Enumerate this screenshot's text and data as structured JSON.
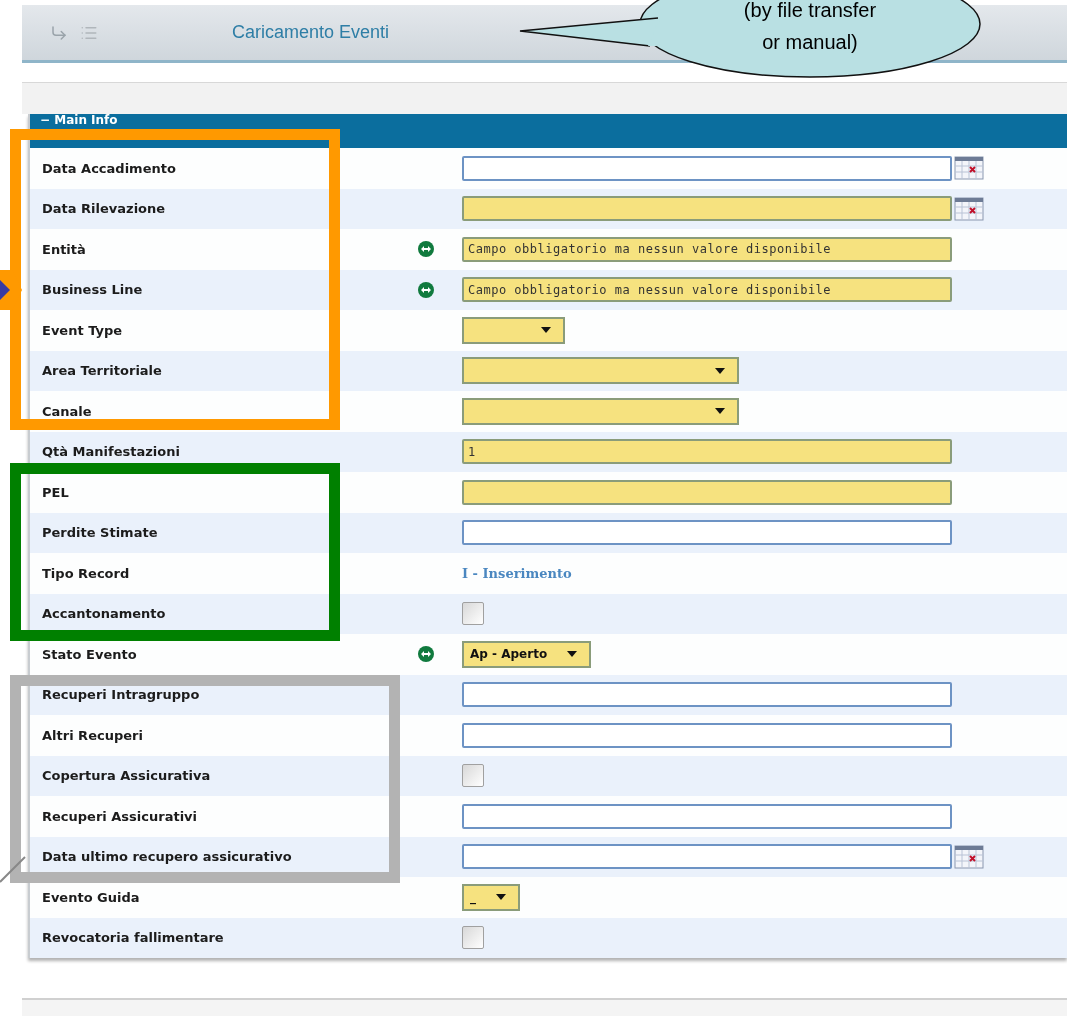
{
  "header": {
    "title": "Caricamento Eventi"
  },
  "callout": {
    "lines": [
      "(by file transfer",
      "or manual)"
    ]
  },
  "section": {
    "title": "− Main Info"
  },
  "rows": [
    {
      "label": "Data Accadimento",
      "kind": "date",
      "required": false,
      "linked": false
    },
    {
      "label": "Data Rilevazione",
      "kind": "date",
      "required": true,
      "linked": false
    },
    {
      "label": "Entità",
      "kind": "text",
      "required": true,
      "linked": true,
      "value": "Campo obbligatorio ma nessun valore disponibile"
    },
    {
      "label": "Business Line",
      "kind": "text",
      "required": true,
      "linked": true,
      "value": "Campo obbligatorio ma nessun valore disponibile"
    },
    {
      "label": "Event Type",
      "kind": "select",
      "required": true,
      "linked": false
    },
    {
      "label": "Area Territoriale",
      "kind": "combo",
      "required": true,
      "linked": false
    },
    {
      "label": "Canale",
      "kind": "combo",
      "required": true,
      "linked": false
    },
    {
      "label": "Qtà Manifestazioni",
      "kind": "text",
      "required": true,
      "linked": false,
      "value": "1"
    },
    {
      "label": "PEL",
      "kind": "text",
      "required": true,
      "linked": false
    },
    {
      "label": "Perdite Stimate",
      "kind": "text",
      "required": false,
      "linked": false
    },
    {
      "label": "Tipo Record",
      "kind": "static",
      "linked": false,
      "value": "I - Inserimento"
    },
    {
      "label": "Accantonamento",
      "kind": "checkbox",
      "checked": false,
      "linked": false
    },
    {
      "label": "Stato Evento",
      "kind": "select",
      "required": true,
      "linked": true,
      "value": "Ap - Aperto"
    },
    {
      "label": "Recuperi Intragruppo",
      "kind": "text",
      "required": false,
      "linked": false
    },
    {
      "label": "Altri Recuperi",
      "kind": "text",
      "required": false,
      "linked": false
    },
    {
      "label": "Copertura Assicurativa",
      "kind": "checkbox",
      "checked": false,
      "linked": false
    },
    {
      "label": "Recuperi Assicurativi",
      "kind": "text",
      "required": false,
      "linked": false
    },
    {
      "label": "Data ultimo recupero assicurativo",
      "kind": "date",
      "required": false,
      "linked": false
    },
    {
      "label": "Evento Guida",
      "kind": "select",
      "required": true,
      "linked": false,
      "value": "_"
    },
    {
      "label": "Revocatoria fallimentare",
      "kind": "checkbox",
      "checked": false,
      "linked": false
    }
  ],
  "frames": [
    {
      "color": "#ff9900"
    },
    {
      "color": "#008000"
    },
    {
      "color": "#b3b3b3"
    }
  ]
}
